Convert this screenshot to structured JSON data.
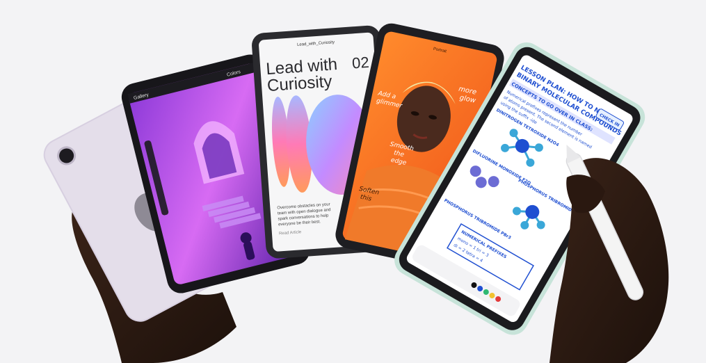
{
  "background_color": "#f3f3f5",
  "devices": {
    "back_tablet": {
      "color": "#e4deea",
      "logo_icon": "apple-logo-icon",
      "camera_icon": "camera-icon"
    },
    "procreate": {
      "menu_left": "Gallery",
      "panel_title": "Colors"
    },
    "magazine": {
      "url": "Lead_with_Curiosity",
      "title_line1": "Lead with",
      "title_line2": "Curiosity",
      "issue": "02",
      "body_line1": "Overcome obstacles on your",
      "body_line2": "team with open dialogue and",
      "body_line3": "spark conversations to help",
      "body_line4": "everyone be their best.",
      "footer": "Read Article"
    },
    "portrait": {
      "header": "Portrait",
      "note1_line1": "more",
      "note1_line2": "glow",
      "note2_line1": "Add a",
      "note2_line2": "glimmer",
      "note3_line1": "Smooth",
      "note3_line2": "the",
      "note3_line3": "edge",
      "note4_line1": "Soften",
      "note4_line2": "this",
      "accent_color": "#f07a2a"
    },
    "notes": {
      "line1": "LESSON PLAN: HOW TO NAME",
      "line2": "BINARY MOLECULAR COMPOUNDS",
      "line3": "CONCEPTS TO GO OVER IN CLASS:",
      "line4": "Numerical prefixes represent the number",
      "line5": "of atoms present. The second element is named",
      "line6": "using the suffix -ide",
      "line7": "DINITROGEN TETROXIDE N2O4",
      "line8": "DIFLUORINE MONOXIDE F2O",
      "line9": "PHOSPHORUS TRIBROMIDE",
      "line10": "PHOSPHORUS TRIBROMIDE PBr3",
      "line11": "NUMERICAL PREFIXES",
      "line12": "mono = 1   tri = 3",
      "line13": "di = 2   tetra = 4",
      "badge": "CHECK IN",
      "ink_color": "#1f4fd1",
      "molecule_color": "#3aa7d8",
      "highlight_color": "#6c6cd4"
    },
    "pencil": {
      "icon": "apple-pencil-icon",
      "color": "#f4f4f4"
    }
  }
}
